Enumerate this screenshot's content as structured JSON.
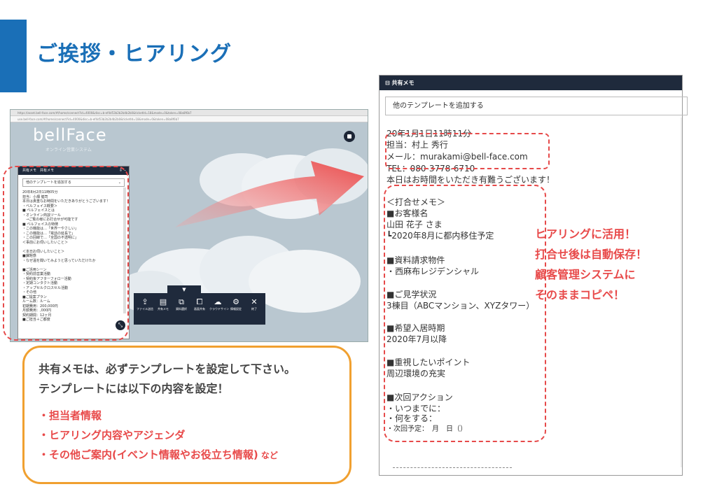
{
  "slide": {
    "title": "ご挨拶・ヒアリング",
    "accent_color": "#1a6fb7"
  },
  "screenshot": {
    "tab_text": "https://asset.bell-face.com/#/home/connect?id=4000&disc=b-ef4d53b2b2b4b2b0&ticketId=18&mode=0&token=08a8f6b7",
    "address_text": "use.bell-face.com/#/home/connect?id=4000&disc=b-ef4d53b2b2b4b2b0&ticketId=18&mode=0&token=08a8f6b7",
    "logo": "bellFace",
    "logo_sub": "オンライン営業システム",
    "mini_panel": {
      "title": "共有メモ　共有メモ",
      "select_value": "他のテンプレートを追加する",
      "body": "20年8月2日11時05分\n担当：小畑 健司\n本日は貴重なお時間をいただきありがとうございます！\n・ベルフェイス概要＞\n■ ベルフェイスとは\n・オンライン商談ツール\n　→ご覧の様にお打合せが可能です\n■ ベルフェイスの特徴\n・この機能は…「世界一やさしい」\n・この機能は…「電話の延長で」\n・この回線で…「全国の不透明に」\n＜事前にお伺いしたいこと＞\n\n＜本日お伺いしたいこと＞\n■課題感\n・なぜ温を聞いてみようと思っていただけたか\n\n■ご活用シーン\n・契約前営業活動\n・契約後アフターフォロー活動\n・定期コンタクト活動\n・アップセルクロスセル活動\n・その他\n■ご提案プラン\nルーム数：ルーム\n初期費用：200,000円\n月額費用：,000円\n契約期間：12ヶ月\n■ご担当＋ご都度"
    },
    "toolbar": {
      "tab_label": "▼",
      "items": [
        {
          "icon": "⇪",
          "label": "ファイル送信"
        },
        {
          "icon": "▤",
          "label": "共有メモ"
        },
        {
          "icon": "⧉",
          "label": "資料選択"
        },
        {
          "icon": "⧠",
          "label": "画面共有"
        },
        {
          "icon": "☁",
          "label": "クラウドサイン"
        },
        {
          "icon": "⚙",
          "label": "情報設定"
        },
        {
          "icon": "✕",
          "label": "終了"
        }
      ]
    }
  },
  "instructions": {
    "line1": "共有メモは、必ずテンプレートを設定して下さい。",
    "line2": "テンプレートには以下の内容を設定！",
    "bullets": [
      {
        "text": "・担当者情報",
        "suffix": ""
      },
      {
        "text": "・ヒアリング内容やアジェンダ",
        "suffix": ""
      },
      {
        "text": "・その他ご案内(イベント情報やお役立ち情報)",
        "suffix": " など"
      }
    ],
    "border_color": "#f0a030",
    "highlight_color": "#e84a4a"
  },
  "memo": {
    "title": "共有メモ",
    "select_value": "他のテンプレートを追加する",
    "lines": [
      "20年1月1日11時11分",
      "担当：村上 秀行",
      "メール：murakami@bell-face.com",
      "TEL：080-3778-6710",
      "本日はお時間をいただき有難うございます！",
      "＜打合せメモ＞",
      "■お客様名",
      "山田 花子 さま",
      "┗2020年8月に都内移住予定",
      "■資料請求物件",
      "・西麻布レジデンシャル",
      "■ご見学状況",
      "3棟目（ABCマンション、XYZタワー）",
      "■希望入居時期",
      "2020年7月以降",
      "■重視したいポイント",
      "周辺環境の充実",
      "■次回アクション",
      "・いつまでに：",
      "・何をする：",
      "・次回予定：　月　日（）"
    ]
  },
  "callouts": [
    "ヒアリングに活用！",
    "打合せ後は自動保存！",
    "顧客管理システムに",
    "そのままコピペ！"
  ]
}
